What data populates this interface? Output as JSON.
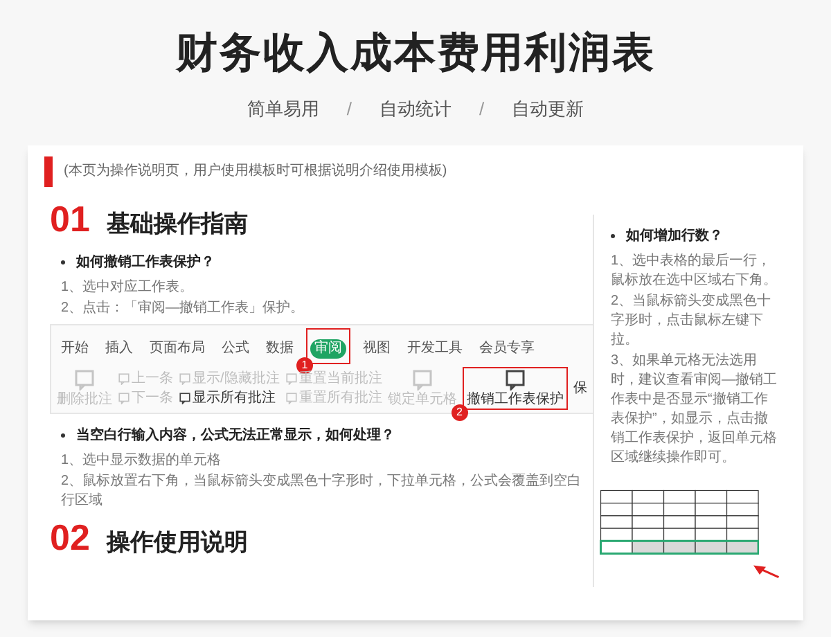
{
  "title": "财务收入成本费用利润表",
  "taglines": [
    {
      "kind": "tag",
      "text": "简单易用"
    },
    {
      "kind": "sep",
      "text": "/"
    },
    {
      "kind": "tag",
      "text": "自动统计"
    },
    {
      "kind": "sep",
      "text": "/"
    },
    {
      "kind": "tag",
      "text": "自动更新"
    }
  ],
  "note": "(本页为操作说明页，用户使用模板时可根据说明介绍使用模板)",
  "left": [
    {
      "kind": "section",
      "number": "01",
      "heading": "基础操作指南"
    },
    {
      "kind": "question",
      "text": "如何撤销工作表保护？"
    },
    {
      "kind": "steps",
      "items": [
        "1、选中对应工作表。",
        "2、点击：「审阅—撤销工作表」保护。"
      ]
    },
    {
      "kind": "toolbar"
    },
    {
      "kind": "question",
      "text": "当空白行输入内容，公式无法正常显示，如何处理？"
    },
    {
      "kind": "steps",
      "items": [
        "1、选中显示数据的单元格",
        "2、鼠标放置右下角，当鼠标箭头变成黑色十字形时，下拉单元格，公式会覆盖到空白行区域"
      ]
    },
    {
      "kind": "section",
      "number": "02",
      "heading": "操作使用说明"
    }
  ],
  "toolbar": {
    "tabs": [
      {
        "label": "开始",
        "selected": false
      },
      {
        "label": "插入",
        "selected": false
      },
      {
        "label": "页面布局",
        "selected": false
      },
      {
        "label": "公式",
        "selected": false
      },
      {
        "label": "数据",
        "selected": false
      },
      {
        "label": "审阅",
        "selected": true,
        "badge": "1"
      },
      {
        "label": "视图",
        "selected": false
      },
      {
        "label": "开发工具",
        "selected": false
      },
      {
        "label": "会员专享",
        "selected": false
      }
    ],
    "command_groups": [
      [
        {
          "label": "删除批注",
          "disabled": true,
          "highlighted": false
        }
      ],
      [
        {
          "label": "上一条",
          "disabled": true,
          "highlighted": false
        },
        {
          "label": "下一条",
          "disabled": true,
          "highlighted": false
        }
      ],
      [
        {
          "label": "显示/隐藏批注",
          "disabled": true,
          "highlighted": false
        },
        {
          "label": "显示所有批注",
          "disabled": false,
          "highlighted": false
        }
      ],
      [
        {
          "label": "重置当前批注",
          "disabled": true,
          "highlighted": false
        },
        {
          "label": "重置所有批注",
          "disabled": true,
          "highlighted": false
        }
      ],
      [
        {
          "label": "锁定单元格",
          "disabled": true,
          "highlighted": false
        }
      ],
      [
        {
          "label": "撤销工作表保护",
          "disabled": false,
          "highlighted": true,
          "badge": "2"
        }
      ],
      [
        {
          "label": "保",
          "disabled": false,
          "highlighted": false
        }
      ]
    ]
  },
  "right": [
    {
      "kind": "question",
      "text": "如何增加行数？"
    },
    {
      "kind": "steps",
      "items": [
        "1、选中表格的最后一行，鼠标放在选中区域右下角。",
        "2、当鼠标箭头变成黑色十字形时，点击鼠标左键下拉。",
        "3、如果单元格无法选用时，建议查看审阅—撤销工作表中是否显示“撤销工作表保护”，如显示，点击撤销工作表保护，返回单元格区域继续操作即可。"
      ]
    },
    {
      "kind": "table"
    }
  ]
}
